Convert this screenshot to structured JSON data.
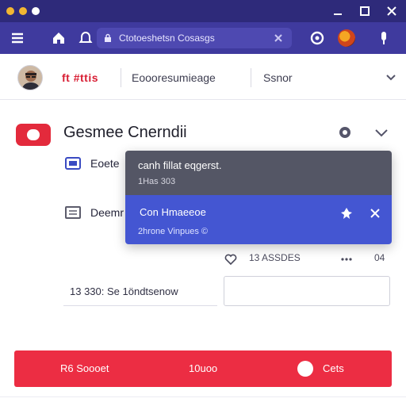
{
  "colors": {
    "titlebar": "#2e2a7a",
    "toolbar": "#3f3a9e",
    "brand_red": "#d81e34",
    "popup_dark": "#545665",
    "popup_blue": "#4456d2",
    "action_bar": "#ec2d43"
  },
  "browser": {
    "address_text": "Ctotoeshetsn Cosasgs",
    "icons": [
      "menu-icon",
      "home-icon",
      "bell-icon",
      "lock-icon",
      "close-icon",
      "help-circle-icon",
      "user-avatar",
      "microphone-icon"
    ]
  },
  "header": {
    "brand": "ft #ttis",
    "link_1": "Eoooresumieage",
    "link_2": "Ssnor"
  },
  "section": {
    "title": "Gesmee Cnerndii",
    "items": [
      {
        "label": "Eoete",
        "icon": "mail-icon"
      },
      {
        "label": "Deemr",
        "icon": "list-icon"
      }
    ]
  },
  "popup": {
    "top_title": "canh fillat eqgerst.",
    "top_sub": "1Has 303",
    "bottom_title": "Con Hmaeeoe",
    "bottom_sub": "2hrone Vinpues ©"
  },
  "meta": {
    "reactions": "13 ASSDES",
    "count": "04"
  },
  "form": {
    "text_value": "13 330: Se 1öndtsenow",
    "box_value": ""
  },
  "action_bar": {
    "left_label": "R6 Soooet",
    "middle_label": "10uoo",
    "right_label": "Cets"
  }
}
